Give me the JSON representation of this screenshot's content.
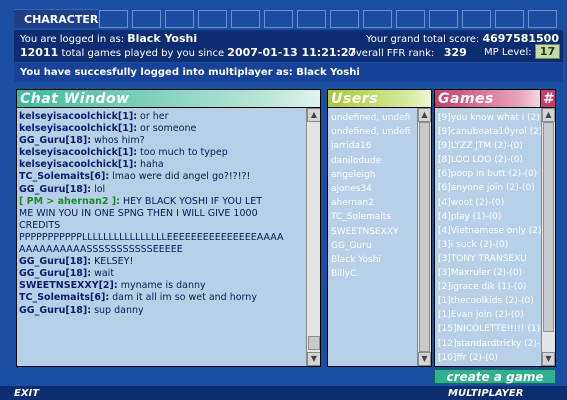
{
  "header": {
    "character_label": "CHARACTER",
    "logged_in_prefix": "You are logged in as:",
    "username": "Black Yoshi",
    "games_count": "12011",
    "games_played_text": "total games played by you since",
    "since_date": "2007-01-13 11:21:27",
    "grand_total_label": "Your grand total score:",
    "grand_total": "4697581500",
    "ffr_rank_label": "Overall FFR rank:",
    "ffr_rank": "329",
    "mp_level_label": "MP Level:",
    "mp_level": "17"
  },
  "login_message": "You have succesfully logged into multiplayer as: Black Yoshi",
  "chat": {
    "title": "Chat Window",
    "lines": [
      {
        "name": "kelseyisacoolchick[1]:",
        "text": " or her"
      },
      {
        "name": "kelseyisacoolchick[1]:",
        "text": " or someone"
      },
      {
        "name": "GG_Guru[18]:",
        "text": " whos him?"
      },
      {
        "name": "kelseyisacoolchick[1]:",
        "text": " too much to typep"
      },
      {
        "name": "kelseyisacoolchick[1]:",
        "text": " haha"
      },
      {
        "name": "TC_Solemaits[6]:",
        "text": " lmao were did angel go?!?!?!"
      },
      {
        "name": "GG_Guru[18]:",
        "text": " lol"
      },
      {
        "pm": "[ PM > ahernan2 ]:",
        "text": " HEY BLACK YOSHI IF YOU LET"
      },
      {
        "text": "ME WIN YOU IN ONE SPNG THEN I WILL GIVE 1000"
      },
      {
        "text": "CREDITS"
      },
      {
        "text": "PPPPPPPPPPPLLLLLLLLLLLLLLLLEEEEEEEEEEEEEEEAAAA"
      },
      {
        "text": "AAAAAAAAAASSSSSSSSSSSEEEEE"
      },
      {
        "name": "GG_Guru[18]:",
        "text": " KELSEY!"
      },
      {
        "name": "GG_Guru[18]:",
        "text": " wait"
      },
      {
        "name": "SWEETNSEXXY[2]:",
        "text": " myname is danny"
      },
      {
        "name": "TC_Solemaits[6]:",
        "text": " dam it all im so wet and horny"
      },
      {
        "name": "GG_Guru[18]:",
        "text": " sup danny"
      }
    ]
  },
  "users": {
    "title": "Users",
    "items": [
      "undefined, undefi",
      "undefined, undefi",
      "jarrida16",
      "danilodude",
      "angeleigh",
      "ajones34",
      "ahernan2",
      "TC_Solemaits",
      "SWEETNSEXXY",
      "GG_Guru",
      "Black Yoshi",
      "BillyC."
    ]
  },
  "games": {
    "title": "Games",
    "hash_label": "#",
    "items": [
      "[9]you know what i (2)",
      "[9]canubeata10yrol (2)",
      "[9]LYZZ JTM (2)-(0)",
      "[8]LOO LOO (2)-(0)",
      "[6]poop in butt (2)-(0)",
      "[6]anyone join (2)-(0)",
      "[4]woot (2)-(0)",
      "[4]play (1)-(0)",
      "[4]Vietnamese only (2)",
      "[3]i suck (2)-(0)",
      "[3]TONY TRANSEXU",
      "[3]Maxruler (2)-(0)",
      "[2]igrace dik (1)-(0)",
      "[1]thecoolkids (2)-(0)",
      "[1]Evan join (2)-(0)",
      "[15]NICOLETTE!!!!! (1)",
      "[12]standardtricky (2)-",
      "[10]ffr (2)-(0)"
    ],
    "create_label": "create a game"
  },
  "footer": {
    "exit_label": "EXIT",
    "multiplayer_label": "MULTIPLAYER"
  }
}
